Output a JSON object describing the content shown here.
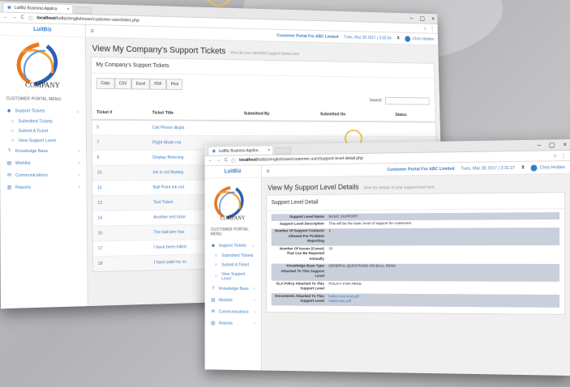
{
  "window_back": {
    "tab_title": "LuitBiz Business Applica",
    "url_host": "localhost",
    "url_path": "/luitbiz/english/user/customer-user/index.php",
    "brand": "LuitBiz",
    "logo_text": "COMPANY",
    "menu_header": "CUSTOMER PORTAL MENU",
    "menu": {
      "support_tickets": "Support Tickets",
      "submitted_tickets": "Submitted Tickets",
      "submit_ticket": "Submit A Ticket",
      "view_support_level": "View Support Level",
      "knowledge_base": "Knowledge Base",
      "wishlist": "Wishlist",
      "communications": "Communications",
      "reports": "Reports"
    },
    "topnav": {
      "portal": "Customer Portal For ABC Limited",
      "datetime": "Tues, Mar 28 2017 | 3:30:34",
      "user": "Chris Holden"
    },
    "page_title": "View My Company's Support Tickets",
    "page_subtitle": "View all your submitted support tickets here",
    "panel_title": "My Company's Support Tickets",
    "buttons": [
      "Copy",
      "CSV",
      "Excel",
      "PDF",
      "Print"
    ],
    "search_label": "Search:",
    "columns": [
      "Ticket #",
      "Ticket Title",
      "Submitted By",
      "Submitted On",
      "Status"
    ],
    "rows": [
      {
        "id": "5",
        "title": "Cell Phone displa"
      },
      {
        "id": "7",
        "title": "Flight Mode not"
      },
      {
        "id": "8",
        "title": "Display flickering"
      },
      {
        "id": "10",
        "title": "Ink is not flowing"
      },
      {
        "id": "12",
        "title": "Ball Point Ink not"
      },
      {
        "id": "13",
        "title": "Test Ticket"
      },
      {
        "id": "14",
        "title": "Another test ticke"
      },
      {
        "id": "16",
        "title": "The ball pen has"
      },
      {
        "id": "17",
        "title": "I have been billed"
      },
      {
        "id": "18",
        "title": "I have paid my su"
      }
    ]
  },
  "window_front": {
    "tab_title": "LuitBiz Business Applica",
    "url_host": "localhost",
    "url_path": "/luitbiz/english/user/customer-user/support-level-detail.php",
    "brand": "LuitBiz",
    "logo_text": "COMPANY",
    "menu_header": "CUSTOMER PORTAL MENU",
    "menu": {
      "support_tickets": "Support Tickets",
      "submitted_tickets": "Submitted Tickets",
      "submit_ticket": "Submit A Ticket",
      "view_support_level": "View Support Level",
      "knowledge_base": "Knowledge Base",
      "wishlist": "Wishlist",
      "communications": "Communications",
      "reports": "Reports"
    },
    "topnav": {
      "portal": "Customer Portal For ABC Limited",
      "datetime": "Tues, Mar 28 2017 | 3:31:27",
      "user": "Chris Holden"
    },
    "page_title": "View My Support Level Details",
    "page_subtitle": "View the details of your support level here",
    "panel_title": "Support Level Detail",
    "details": [
      {
        "label": "Support Level Name",
        "value": "BASIC SUPPORT",
        "shade": true
      },
      {
        "label": "Support Level Description",
        "value": "This will be the basic level of support for customers",
        "shade": false
      },
      {
        "label": "Number Of Support Contacts Allowed For Problem Reporting",
        "value": "1",
        "shade": true
      },
      {
        "label": "Number Of Issues (Cases) That Can Be Reported Annually",
        "value": "10",
        "shade": false
      },
      {
        "label": "Knowledge Base Type Attached To This Support Level",
        "value": "GENERAL QUESTIONS ON BALL PENS",
        "shade": true
      },
      {
        "label": "SLA Policy Attached To This Support Level",
        "value": "POLICY FOR PENS",
        "shade": false
      },
      {
        "label": "Documents Attached To This Support Level",
        "value": "luitbiz-new-test.pdf",
        "value2": "luitbiz-test.pdf",
        "shade": true
      }
    ]
  },
  "colors": {
    "accent": "#3a7dc4",
    "detail_shade": "#c9cfdb"
  }
}
